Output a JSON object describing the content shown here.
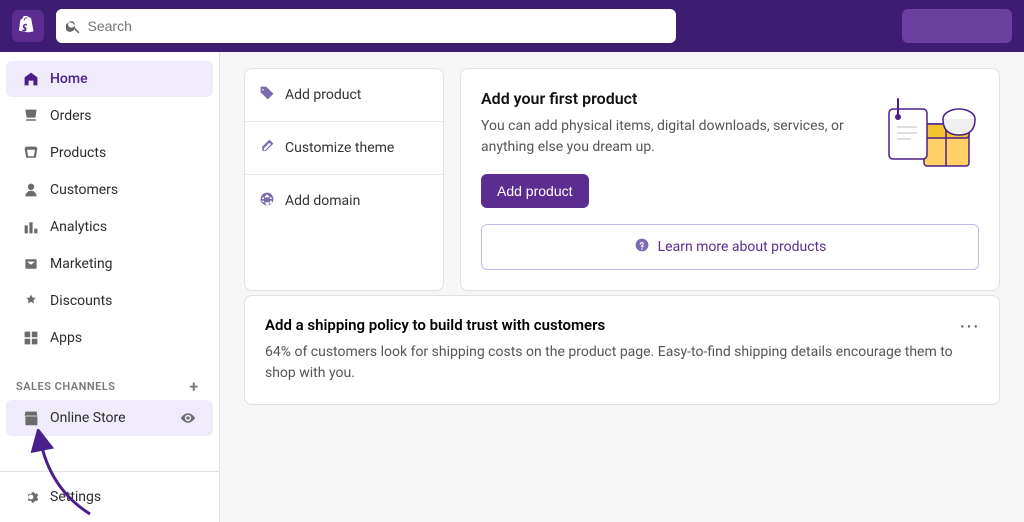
{
  "topnav": {
    "logo_label": "Shopify",
    "search_placeholder": "Search"
  },
  "sidebar": {
    "items": [
      {
        "id": "home",
        "label": "Home",
        "icon": "home-icon",
        "active": true
      },
      {
        "id": "orders",
        "label": "Orders",
        "icon": "orders-icon",
        "active": false
      },
      {
        "id": "products",
        "label": "Products",
        "icon": "products-icon",
        "active": false
      },
      {
        "id": "customers",
        "label": "Customers",
        "icon": "customers-icon",
        "active": false
      },
      {
        "id": "analytics",
        "label": "Analytics",
        "icon": "analytics-icon",
        "active": false
      },
      {
        "id": "marketing",
        "label": "Marketing",
        "icon": "marketing-icon",
        "active": false
      },
      {
        "id": "discounts",
        "label": "Discounts",
        "icon": "discounts-icon",
        "active": false
      },
      {
        "id": "apps",
        "label": "Apps",
        "icon": "apps-icon",
        "active": false
      }
    ],
    "sales_channels_label": "SALES CHANNELS",
    "online_store_label": "Online Store",
    "settings_label": "Settings"
  },
  "action_list": {
    "items": [
      {
        "label": "Add product",
        "icon": "tag-icon"
      },
      {
        "label": "Customize theme",
        "icon": "brush-icon"
      },
      {
        "label": "Add domain",
        "icon": "globe-icon"
      }
    ]
  },
  "product_promo": {
    "title": "Add your first product",
    "description": "You can add physical items, digital downloads, services, or anything else you dream up.",
    "cta_label": "Add product",
    "learn_more_label": "Learn more about products"
  },
  "shipping_card": {
    "title": "Add a shipping policy to build trust with customers",
    "description": "64% of customers look for shipping costs on the product page. Easy-to-find shipping details encourage them to shop with you.",
    "dots_label": "···"
  }
}
